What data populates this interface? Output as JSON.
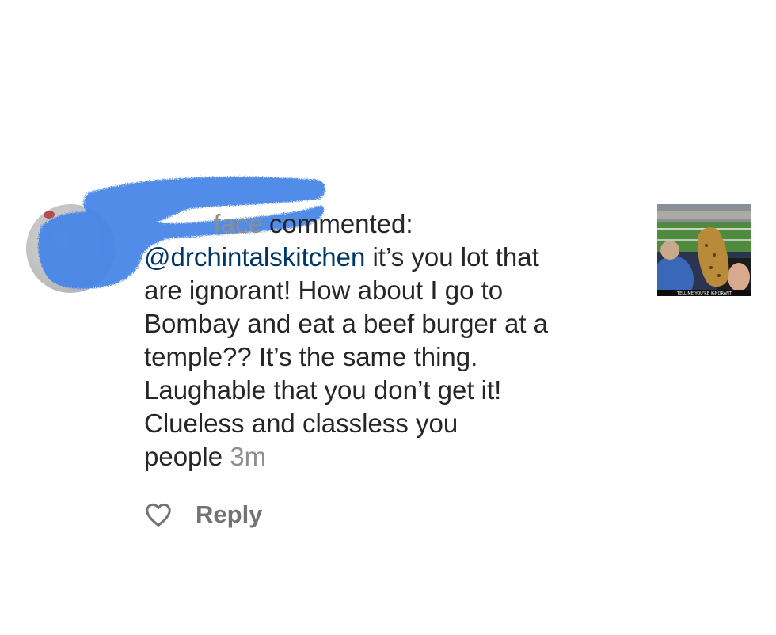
{
  "notification": {
    "author_fragment": "face",
    "action_text": "commented:",
    "mention": "@drchintalskitchen",
    "comment_lines": [
      "it’s you lot that",
      "are ignorant! How about I go to",
      "Bombay and eat a beef burger at a",
      "temple?? It’s the same thing.",
      "Laughable that you don’t get it!",
      "Clueless and classless you",
      "people"
    ],
    "time_ago": "3m",
    "reply_label": "Reply",
    "thumbnail_caption": "TELL ME YOU'RE IGNORANT"
  },
  "colors": {
    "text": "#262626",
    "mention": "#00376b",
    "secondary": "#8e8e8e",
    "redaction_blue": "#4a86e8"
  },
  "icons": {
    "like": "heart-outline-icon"
  }
}
